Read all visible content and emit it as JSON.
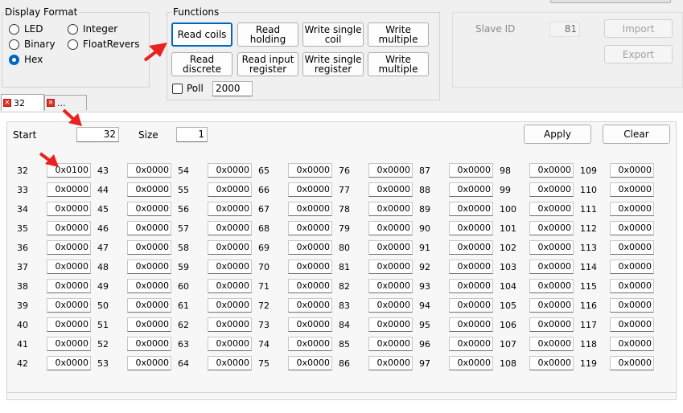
{
  "display_format": {
    "title": "Display Format",
    "options": [
      {
        "label": "LED",
        "selected": false
      },
      {
        "label": "Integer",
        "selected": false
      },
      {
        "label": "Binary",
        "selected": false
      },
      {
        "label": "FloatRevers",
        "selected": false
      },
      {
        "label": "Hex",
        "selected": true
      }
    ]
  },
  "functions": {
    "title": "Functions",
    "buttons": [
      "Read coils",
      "Read\nholding",
      "Write single\ncoil",
      "Write\nmultiple",
      "Read\ndiscrete",
      "Read input\nregister",
      "Write single\nregister",
      "Write\nmultiple"
    ],
    "poll_label": "Poll",
    "poll_checked": false,
    "poll_interval": "2000"
  },
  "slave": {
    "id_label": "Slave ID",
    "id_value": "81",
    "import_label": "Import",
    "export_label": "Export"
  },
  "tabs": [
    {
      "label": "32",
      "active": true
    },
    {
      "label": "...",
      "active": false
    }
  ],
  "range": {
    "start_label": "Start",
    "start_value": "32",
    "size_label": "Size",
    "size_value": "1",
    "apply_label": "Apply",
    "clear_label": "Clear"
  },
  "registers": [
    {
      "addr": "32",
      "value": "0x0100"
    },
    {
      "addr": "33",
      "value": "0x0000"
    },
    {
      "addr": "34",
      "value": "0x0000"
    },
    {
      "addr": "35",
      "value": "0x0000"
    },
    {
      "addr": "36",
      "value": "0x0000"
    },
    {
      "addr": "37",
      "value": "0x0000"
    },
    {
      "addr": "38",
      "value": "0x0000"
    },
    {
      "addr": "39",
      "value": "0x0000"
    },
    {
      "addr": "40",
      "value": "0x0000"
    },
    {
      "addr": "41",
      "value": "0x0000"
    },
    {
      "addr": "42",
      "value": "0x0000"
    },
    {
      "addr": "43",
      "value": "0x0000"
    },
    {
      "addr": "44",
      "value": "0x0000"
    },
    {
      "addr": "45",
      "value": "0x0000"
    },
    {
      "addr": "46",
      "value": "0x0000"
    },
    {
      "addr": "47",
      "value": "0x0000"
    },
    {
      "addr": "48",
      "value": "0x0000"
    },
    {
      "addr": "49",
      "value": "0x0000"
    },
    {
      "addr": "50",
      "value": "0x0000"
    },
    {
      "addr": "51",
      "value": "0x0000"
    },
    {
      "addr": "52",
      "value": "0x0000"
    },
    {
      "addr": "53",
      "value": "0x0000"
    },
    {
      "addr": "54",
      "value": "0x0000"
    },
    {
      "addr": "55",
      "value": "0x0000"
    },
    {
      "addr": "56",
      "value": "0x0000"
    },
    {
      "addr": "57",
      "value": "0x0000"
    },
    {
      "addr": "58",
      "value": "0x0000"
    },
    {
      "addr": "59",
      "value": "0x0000"
    },
    {
      "addr": "60",
      "value": "0x0000"
    },
    {
      "addr": "61",
      "value": "0x0000"
    },
    {
      "addr": "62",
      "value": "0x0000"
    },
    {
      "addr": "63",
      "value": "0x0000"
    },
    {
      "addr": "64",
      "value": "0x0000"
    },
    {
      "addr": "65",
      "value": "0x0000"
    },
    {
      "addr": "66",
      "value": "0x0000"
    },
    {
      "addr": "67",
      "value": "0x0000"
    },
    {
      "addr": "68",
      "value": "0x0000"
    },
    {
      "addr": "69",
      "value": "0x0000"
    },
    {
      "addr": "70",
      "value": "0x0000"
    },
    {
      "addr": "71",
      "value": "0x0000"
    },
    {
      "addr": "72",
      "value": "0x0000"
    },
    {
      "addr": "73",
      "value": "0x0000"
    },
    {
      "addr": "74",
      "value": "0x0000"
    },
    {
      "addr": "75",
      "value": "0x0000"
    },
    {
      "addr": "76",
      "value": "0x0000"
    },
    {
      "addr": "77",
      "value": "0x0000"
    },
    {
      "addr": "78",
      "value": "0x0000"
    },
    {
      "addr": "79",
      "value": "0x0000"
    },
    {
      "addr": "80",
      "value": "0x0000"
    },
    {
      "addr": "81",
      "value": "0x0000"
    },
    {
      "addr": "82",
      "value": "0x0000"
    },
    {
      "addr": "83",
      "value": "0x0000"
    },
    {
      "addr": "84",
      "value": "0x0000"
    },
    {
      "addr": "85",
      "value": "0x0000"
    },
    {
      "addr": "86",
      "value": "0x0000"
    },
    {
      "addr": "87",
      "value": "0x0000"
    },
    {
      "addr": "88",
      "value": "0x0000"
    },
    {
      "addr": "89",
      "value": "0x0000"
    },
    {
      "addr": "90",
      "value": "0x0000"
    },
    {
      "addr": "91",
      "value": "0x0000"
    },
    {
      "addr": "92",
      "value": "0x0000"
    },
    {
      "addr": "93",
      "value": "0x0000"
    },
    {
      "addr": "94",
      "value": "0x0000"
    },
    {
      "addr": "95",
      "value": "0x0000"
    },
    {
      "addr": "96",
      "value": "0x0000"
    },
    {
      "addr": "97",
      "value": "0x0000"
    },
    {
      "addr": "98",
      "value": "0x0000"
    },
    {
      "addr": "99",
      "value": "0x0000"
    },
    {
      "addr": "100",
      "value": "0x0000"
    },
    {
      "addr": "101",
      "value": "0x0000"
    },
    {
      "addr": "102",
      "value": "0x0000"
    },
    {
      "addr": "103",
      "value": "0x0000"
    },
    {
      "addr": "104",
      "value": "0x0000"
    },
    {
      "addr": "105",
      "value": "0x0000"
    },
    {
      "addr": "106",
      "value": "0x0000"
    },
    {
      "addr": "107",
      "value": "0x0000"
    },
    {
      "addr": "108",
      "value": "0x0000"
    },
    {
      "addr": "109",
      "value": "0x0000"
    },
    {
      "addr": "110",
      "value": "0x0000"
    },
    {
      "addr": "111",
      "value": "0x0000"
    },
    {
      "addr": "112",
      "value": "0x0000"
    },
    {
      "addr": "113",
      "value": "0x0000"
    },
    {
      "addr": "114",
      "value": "0x0000"
    },
    {
      "addr": "115",
      "value": "0x0000"
    },
    {
      "addr": "116",
      "value": "0x0000"
    },
    {
      "addr": "117",
      "value": "0x0000"
    },
    {
      "addr": "118",
      "value": "0x0000"
    },
    {
      "addr": "119",
      "value": "0x0000"
    }
  ],
  "colors": {
    "accent": "#0067c0",
    "annotation_arrow": "#e8231f"
  }
}
